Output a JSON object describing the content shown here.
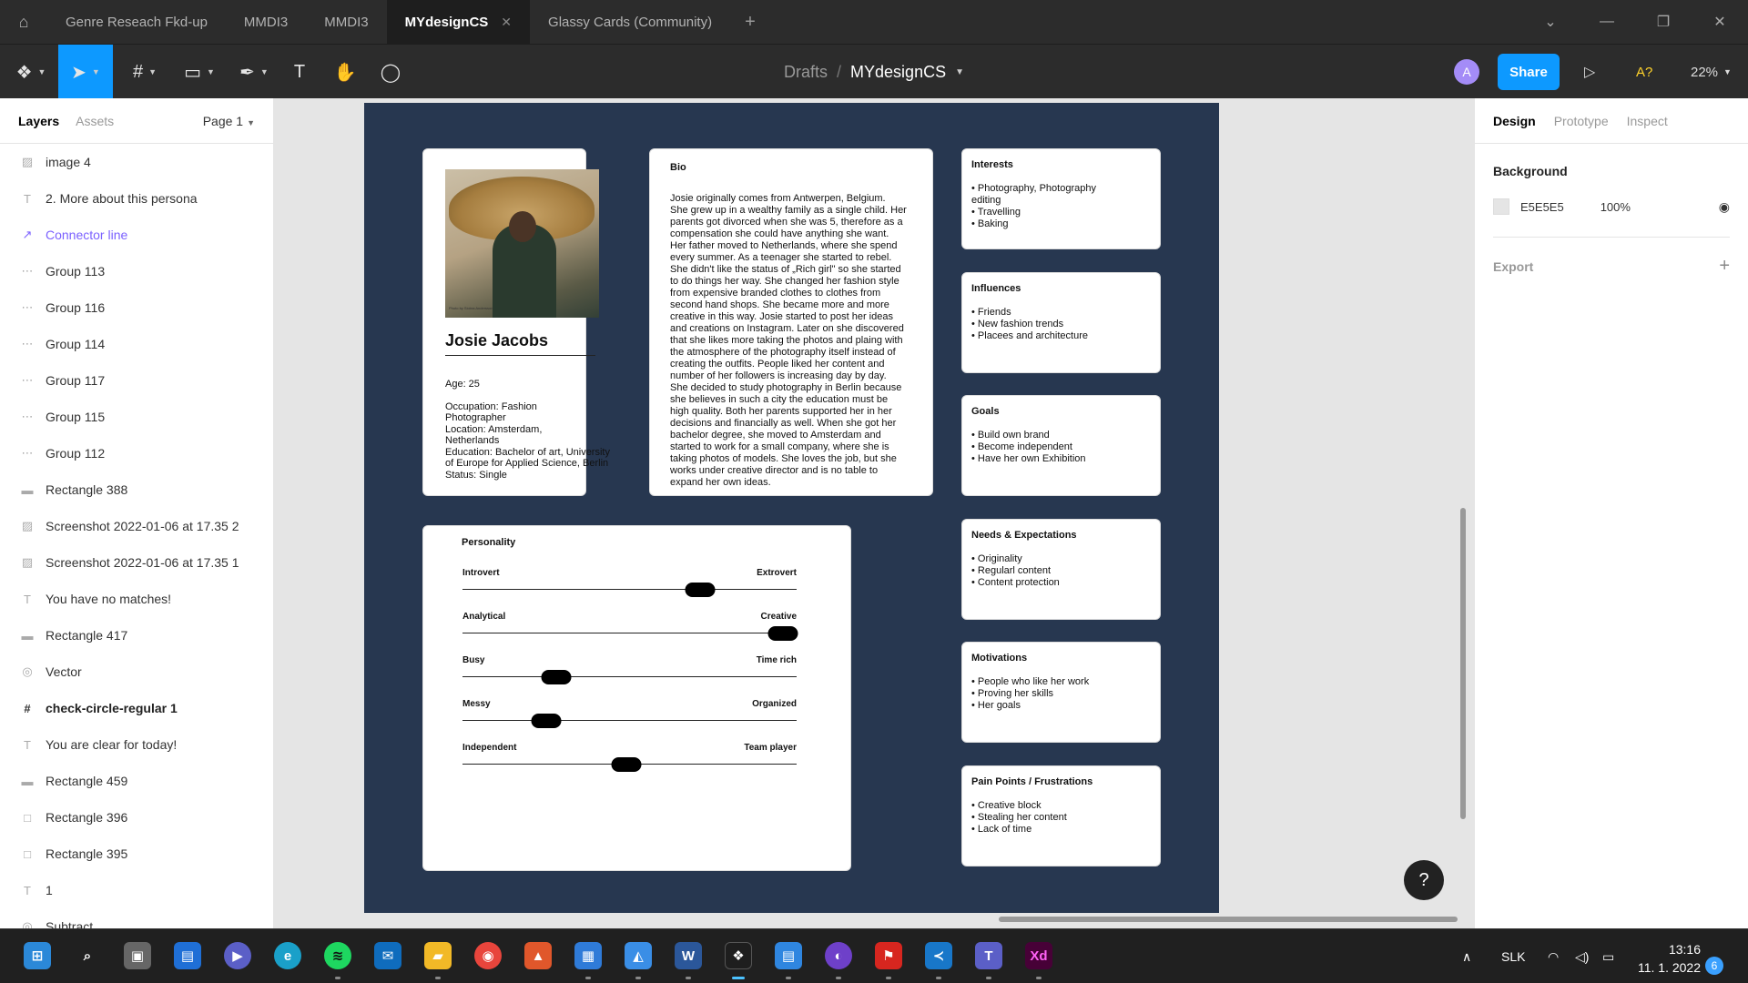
{
  "titlebar": {
    "tabs": [
      {
        "label": "Genre Reseach Fkd-up"
      },
      {
        "label": "MMDI3"
      },
      {
        "label": "MMDI3"
      },
      {
        "label": "MYdesignCS"
      },
      {
        "label": "Glassy Cards (Community)"
      }
    ],
    "active_tab_close": "✕"
  },
  "toolbar": {
    "breadcrumb_root": "Drafts",
    "breadcrumb_sep": "/",
    "file_name": "MYdesignCS",
    "avatar_initial": "A",
    "share_label": "Share",
    "font_warning": "A?",
    "zoom": "22%"
  },
  "layers_panel": {
    "tab_layers": "Layers",
    "tab_assets": "Assets",
    "page_selector": "Page 1",
    "items": [
      {
        "label": "image 4",
        "icon": "image-icon"
      },
      {
        "label": "2. More about this persona",
        "icon": "text-icon"
      },
      {
        "label": "Connector line",
        "icon": "connector-icon"
      },
      {
        "label": "Group 113",
        "icon": "group-icon"
      },
      {
        "label": "Group 116",
        "icon": "group-icon"
      },
      {
        "label": "Group 114",
        "icon": "group-icon"
      },
      {
        "label": "Group 117",
        "icon": "group-icon"
      },
      {
        "label": "Group 115",
        "icon": "group-icon"
      },
      {
        "label": "Group 112",
        "icon": "group-icon"
      },
      {
        "label": "Rectangle 388",
        "icon": "line-rect-icon"
      },
      {
        "label": "Screenshot 2022-01-06 at 17.35 2",
        "icon": "image-icon"
      },
      {
        "label": "Screenshot 2022-01-06 at 17.35 1",
        "icon": "image-icon"
      },
      {
        "label": "You have no matches!",
        "icon": "text-icon"
      },
      {
        "label": "Rectangle 417",
        "icon": "line-rect-icon"
      },
      {
        "label": "Vector",
        "icon": "vector-icon"
      },
      {
        "label": "check-circle-regular 1",
        "icon": "frame-icon"
      },
      {
        "label": "You are clear for today!",
        "icon": "text-icon"
      },
      {
        "label": "Rectangle 459",
        "icon": "line-rect-icon"
      },
      {
        "label": "Rectangle 396",
        "icon": "rect-icon"
      },
      {
        "label": "Rectangle 395",
        "icon": "rect-icon"
      },
      {
        "label": "1",
        "icon": "text-icon"
      },
      {
        "label": "Subtract",
        "icon": "vector-icon"
      }
    ]
  },
  "design_panel": {
    "tabs": [
      "Design",
      "Prototype",
      "Inspect"
    ],
    "background_title": "Background",
    "background_hex": "E5E5E5",
    "background_opacity": "100%",
    "export_title": "Export"
  },
  "persona": {
    "photo_credit": "Photo by Siobra Andersson",
    "name": "Josie Jacobs",
    "age": "Age: 25",
    "details": "Occupation: Fashion\nPhotographer\nLocation: Amsterdam,\nNetherlands\nEducation: Bachelor of art, University\nof Europe for Applied Science, Berlin\nStatus: Single",
    "bio_title": "Bio",
    "bio_text": "Josie originally comes from Antwerpen, Belgium.\nShe grew up in a wealthy family as a single child. Her\nparents got divorced when she was 5, therefore as a\ncompensation she could have anything she want.\nHer father moved to Netherlands, where she spend\nevery summer. As a teenager she started to rebel.\nShe didn't like the status of „Rich girl\" so she started\nto do things her way. She changed her fashion style\nfrom expensive branded clothes to clothes from\nsecond hand shops. She became more and more\ncreative in this way. Josie started to post her ideas\nand creations on Instagram. Later on she discovered\nthat she likes more taking the photos and plaing with\nthe atmosphere of the photography itself instead of\ncreating the outfits. People liked her content and\nnumber of her followers is increasing day by day.\nShe decided to study photography in Berlin because\nshe believes in such a city the education must be\nhigh quality. Both her parents supported her in her\ndecisions and financially as well. When she got her\nbachelor degree, she moved to Amsterdam and\nstarted to work for a small company, where she is\ntaking photos of models. She loves the job, but she\nworks under creative director and is no table to\nexpand her own ideas.",
    "personality_title": "Personality",
    "traits": [
      {
        "left": "Introvert",
        "right": "Extrovert",
        "value": 0.71
      },
      {
        "left": "Analytical",
        "right": "Creative",
        "value": 0.96
      },
      {
        "left": "Busy",
        "right": "Time rich",
        "value": 0.28
      },
      {
        "left": "Messy",
        "right": "Organized",
        "value": 0.25
      },
      {
        "left": "Independent",
        "right": "Team player",
        "value": 0.49
      }
    ],
    "sections": [
      {
        "title": "Interests",
        "items": "• Photography, Photography\nediting\n• Travelling\n• Baking"
      },
      {
        "title": "Influences",
        "items": "• Friends\n• New fashion trends\n• Placees and architecture"
      },
      {
        "title": "Goals",
        "items": "• Build own brand\n• Become independent\n• Have her own Exhibition"
      },
      {
        "title": "Needs & Expectations",
        "items": "• Originality\n• Regularl content\n• Content protection"
      },
      {
        "title": "Motivations",
        "items": "• People who like her work\n• Proving her skills\n• Her goals"
      },
      {
        "title": "Pain Points / Frustrations",
        "items": "• Creative block\n• Stealing her content\n• Lack of time"
      }
    ]
  },
  "help_label": "?",
  "taskbar": {
    "language": "SLK",
    "time": "13:16",
    "date": "11. 1. 2022",
    "notifications": "6",
    "xd_label": "Xd"
  },
  "colors": {
    "accent": "#0d99ff",
    "frame_bg": "#273750",
    "canvas_bg": "#e5e5e5",
    "connector": "#7b61ff"
  }
}
